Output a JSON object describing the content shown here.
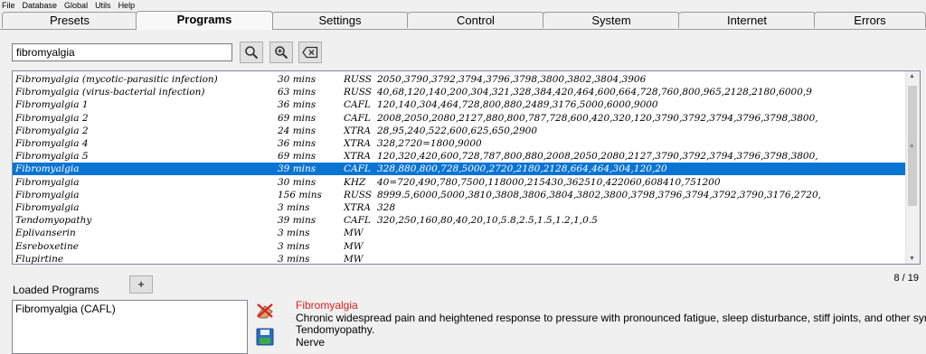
{
  "menu": [
    "File",
    "Database",
    "Global",
    "Utils",
    "Help"
  ],
  "tabs": [
    {
      "label": "Presets"
    },
    {
      "label": "Programs"
    },
    {
      "label": "Settings"
    },
    {
      "label": "Control"
    },
    {
      "label": "System"
    },
    {
      "label": "Internet"
    },
    {
      "label": "Errors"
    }
  ],
  "search": {
    "value": "fibromyalgia"
  },
  "icons": {
    "search": "magnifier-icon",
    "zoom": "zoom-in-icon",
    "clear": "clear-icon",
    "remove": "erase-icon",
    "save": "save-disk-icon"
  },
  "programs": [
    {
      "name": "Fibromyalgia (mycotic-parasitic infection)",
      "duration": "30 mins",
      "type": "RUSS",
      "freqs": "2050,3790,3792,3794,3796,3798,3800,3802,3804,3906"
    },
    {
      "name": "Fibromyalgia (virus-bacterial infection)",
      "duration": "63 mins",
      "type": "RUSS",
      "freqs": "40,68,120,140,200,304,321,328,384,420,464,600,664,728,760,800,965,2128,2180,6000,9"
    },
    {
      "name": "Fibromyalgia 1",
      "duration": "36 mins",
      "type": "CAFL",
      "freqs": "120,140,304,464,728,800,880,2489,3176,5000,6000,9000"
    },
    {
      "name": "Fibromyalgia 2",
      "duration": "69 mins",
      "type": "CAFL",
      "freqs": "2008,2050,2080,2127,880,800,787,728,600,420,320,120,3790,3792,3794,3796,3798,3800,"
    },
    {
      "name": "Fibromyalgia 2",
      "duration": "24 mins",
      "type": "XTRA",
      "freqs": "28,95,240,522,600,625,650,2900"
    },
    {
      "name": "Fibromyalgia 4",
      "duration": "36 mins",
      "type": "XTRA",
      "freqs": "328,2720=1800,9000"
    },
    {
      "name": "Fibromyalgia 5",
      "duration": "69 mins",
      "type": "XTRA",
      "freqs": "120,320,420,600,728,787,800,880,2008,2050,2080,2127,3790,3792,3794,3796,3798,3800,"
    },
    {
      "name": "Fibromyalgia",
      "duration": "39 mins",
      "type": "CAFL",
      "freqs": "328,880,800,728,5000,2720,2180,2128,664,464,304,120,20",
      "selected": true
    },
    {
      "name": "Fibromyalgia",
      "duration": "30 mins",
      "type": "KHZ",
      "freqs": "40=720,490,780,7500,118000,215430,362510,422060,608410,751200"
    },
    {
      "name": "Fibromyalgia",
      "duration": "156 mins",
      "type": "RUSS",
      "freqs": "8999.5,6000,5000,3810,3808,3806,3804,3802,3800,3798,3796,3794,3792,3790,3176,2720,"
    },
    {
      "name": "Fibromyalgia",
      "duration": "3 mins",
      "type": "XTRA",
      "freqs": "328"
    },
    {
      "name": "Tendomyopathy",
      "duration": "39 mins",
      "type": "CAFL",
      "freqs": "320,250,160,80,40,20,10,5.8,2.5,1.5,1.2,1,0.5"
    },
    {
      "name": "Eplivanserin",
      "duration": "3 mins",
      "type": "MW",
      "freqs": ""
    },
    {
      "name": "Esreboxetine",
      "duration": "3 mins",
      "type": "MW",
      "freqs": ""
    },
    {
      "name": "Flupirtine",
      "duration": "3 mins",
      "type": "MW",
      "freqs": ""
    }
  ],
  "counter": "8 / 19",
  "loaded": {
    "label": "Loaded Programs",
    "add_label": "+",
    "items": [
      "Fibromyalgia (CAFL)"
    ]
  },
  "description": {
    "title": "Fibromyalgia",
    "lines": [
      "Chronic widespread pain and heightened response to pressure with pronounced fatigue, sleep disturbance, stiff joints, and other symptoms.",
      "Tendomyopathy.",
      "Nerve"
    ]
  },
  "colors": {
    "selection": "#0a74d3",
    "description_title": "#e02020"
  }
}
